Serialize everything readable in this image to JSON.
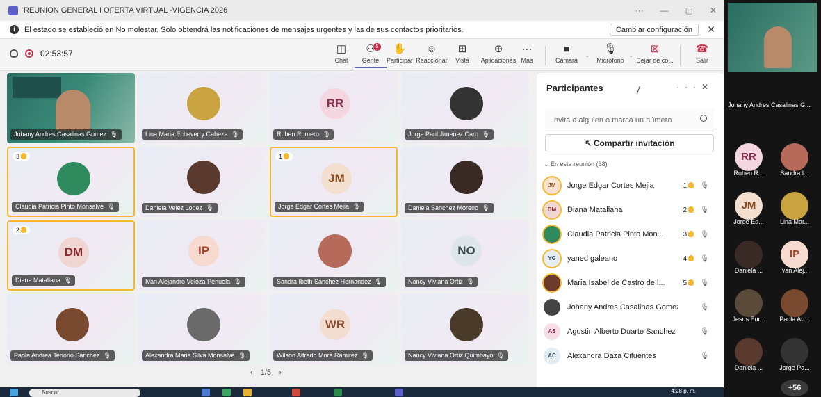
{
  "window": {
    "title": "REUNION GENERAL I OFERTA VIRTUAL -VIGENCIA 2026"
  },
  "banner": {
    "text": "El estado se estableció en No molestar. Solo obtendrá las notificaciones de mensajes urgentes y las de sus contactos prioritarios.",
    "button": "Cambiar configuración"
  },
  "toolbar": {
    "timer": "02:53:57",
    "chat": "Chat",
    "people": "Gente",
    "people_badge": "5",
    "raise": "Participar",
    "react": "Reaccionar",
    "view": "Vista",
    "apps": "Aplicaciones",
    "more": "Más",
    "camera": "Cámara",
    "mic": "Micrófono",
    "share": "Dejar de co...",
    "leave": "Salir"
  },
  "grid": {
    "pager": "1/5",
    "tiles": [
      {
        "name": "Johany Andres Casalinas Gomez",
        "type": "presenter"
      },
      {
        "name": "Lina Maria Echeverry Cabeza",
        "type": "photo",
        "color": "#c9a441"
      },
      {
        "name": "Ruben Romero",
        "type": "initials",
        "initials": "RR",
        "bg": "#f3d6df",
        "fg": "#8a2c4d"
      },
      {
        "name": "Jorge Paul Jimenez Caro",
        "type": "photo",
        "color": "#333333"
      },
      {
        "name": "Claudia Patricia Pinto Monsalve",
        "type": "photo",
        "color": "#2f8a5e",
        "hand": "3"
      },
      {
        "name": "Daniela Velez Lopez",
        "type": "photo",
        "color": "#5a3a2e"
      },
      {
        "name": "Jorge Edgar Cortes Mejia",
        "type": "initials",
        "initials": "JM",
        "bg": "#f3dfd0",
        "fg": "#8a4a1c",
        "hand": "1"
      },
      {
        "name": "Daniela Sanchez Moreno",
        "type": "photo",
        "color": "#3a2a26"
      },
      {
        "name": "Diana Matallana",
        "type": "initials",
        "initials": "DM",
        "bg": "#efd6d3",
        "fg": "#8a2c2c",
        "hand": "2"
      },
      {
        "name": "Ivan Alejandro Veloza Penuela",
        "type": "initials",
        "initials": "IP",
        "bg": "#f6d9cf",
        "fg": "#a8432c"
      },
      {
        "name": "Sandra Ibeth Sanchez Hernandez",
        "type": "photo",
        "color": "#b56a5a"
      },
      {
        "name": "Nancy Viviana Ortiz",
        "type": "initials",
        "initials": "NO",
        "bg": "#dfe6ea",
        "fg": "#3a4a55"
      },
      {
        "name": "Paola Andrea Tenorio Sanchez",
        "type": "photo",
        "color": "#7a4a30"
      },
      {
        "name": "Alexandra Maria Silva Monsalve",
        "type": "photo",
        "color": "#6a6a6a"
      },
      {
        "name": "Wilson Alfredo Mora Ramirez",
        "type": "initials",
        "initials": "WR",
        "bg": "#f3dcd0",
        "fg": "#8a4a2c"
      },
      {
        "name": "Nancy Viviana Ortiz Quimbayo",
        "type": "photo",
        "color": "#4a3a2a"
      }
    ]
  },
  "panel": {
    "title": "Participantes",
    "search_placeholder": "Invita a alguien o marca un número",
    "share_invite": "Compartir invitación",
    "in_meeting": "En esta reunión (68)",
    "people": [
      {
        "name": "Jorge Edgar Cortes Mejia",
        "initials": "JM",
        "bg": "#f5e3cf",
        "fg": "#8a4a1c",
        "hand": "1",
        "ring": "#f5b82e"
      },
      {
        "name": "Diana Matallana",
        "initials": "DM",
        "bg": "#efd6d3",
        "fg": "#8a2c2c",
        "hand": "2",
        "ring": "#f5b82e"
      },
      {
        "name": "Claudia Patricia Pinto Mon...",
        "initials": "",
        "bg": "#2f8a5e",
        "fg": "#fff",
        "hand": "3",
        "ring": "#f5b82e"
      },
      {
        "name": "yaned galeano",
        "initials": "YG",
        "bg": "#e6eef3",
        "fg": "#3a5a6a",
        "hand": "4",
        "ring": "#f5b82e"
      },
      {
        "name": "Maria Isabel de Castro de l...",
        "initials": "",
        "bg": "#6a3a2a",
        "fg": "#fff",
        "hand": "5",
        "ring": "#f5b82e"
      },
      {
        "name": "Johany Andres Casalinas Gomez",
        "initials": "",
        "bg": "#444444",
        "fg": "#fff",
        "hand": "",
        "ring": ""
      },
      {
        "name": "Agustin Alberto Duarte Sanchez",
        "initials": "AS",
        "bg": "#f6dde6",
        "fg": "#8a2c4d",
        "hand": "",
        "ring": ""
      },
      {
        "name": "Alexandra Daza Cifuentes",
        "initials": "AC",
        "bg": "#e3eef2",
        "fg": "#3a5a6a",
        "hand": "",
        "ring": ""
      }
    ]
  },
  "taskbar": {
    "search": "Buscar",
    "time": "4:28 p. m."
  },
  "strip": {
    "speaker": "Johany Andres Casalinas G...",
    "people": [
      {
        "label": "Ruben R...",
        "initials": "RR",
        "bg": "#f3d6df",
        "fg": "#8a2c4d"
      },
      {
        "label": "Sandra I...",
        "initials": "",
        "bg": "#b56a5a",
        "fg": "#fff"
      },
      {
        "label": "Jorge Ed...",
        "initials": "JM",
        "bg": "#f3dfd0",
        "fg": "#8a4a1c"
      },
      {
        "label": "Lina Mar...",
        "initials": "",
        "bg": "#c9a441",
        "fg": "#fff"
      },
      {
        "label": "Daniela ...",
        "initials": "",
        "bg": "#3a2a26",
        "fg": "#fff"
      },
      {
        "label": "Ivan Alej...",
        "initials": "IP",
        "bg": "#f6d9cf",
        "fg": "#a8432c"
      },
      {
        "label": "Jesus Enr...",
        "initials": "",
        "bg": "#5a4a3a",
        "fg": "#fff"
      },
      {
        "label": "Paola An...",
        "initials": "",
        "bg": "#7a4a30",
        "fg": "#fff"
      },
      {
        "label": "Daniela ...",
        "initials": "",
        "bg": "#5a3a2e",
        "fg": "#fff"
      },
      {
        "label": "Jorge Pa...",
        "initials": "",
        "bg": "#333333",
        "fg": "#fff"
      }
    ],
    "more": "+56"
  }
}
